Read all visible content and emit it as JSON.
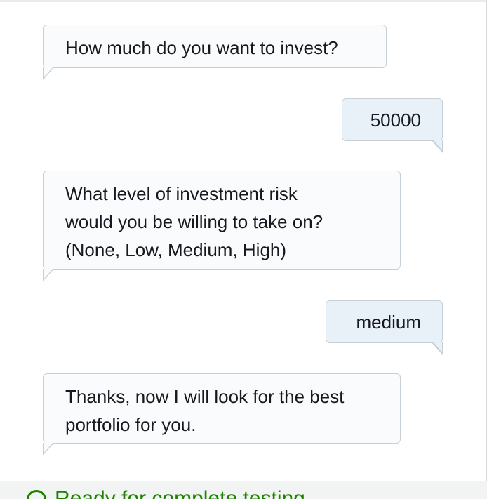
{
  "messages": [
    {
      "sender": "bot",
      "text": "How much do you want to invest?"
    },
    {
      "sender": "user",
      "text": "50000"
    },
    {
      "sender": "bot",
      "lines": [
        "What level of investment risk",
        "would you be willing to take on?",
        "(None, Low, Medium, High)"
      ]
    },
    {
      "sender": "user",
      "text": "medium"
    },
    {
      "sender": "bot",
      "lines": [
        "Thanks, now I will look for the best",
        "portfolio for you."
      ]
    }
  ],
  "footer": {
    "status_icon": "check-circle-icon",
    "status_text": "Ready for complete testing",
    "status_color": "#1d8102"
  },
  "colors": {
    "bot_bubble_bg": "#f9fbfc",
    "user_bubble_bg": "#e8f0f8",
    "bubble_border": "#c6cfd6"
  }
}
